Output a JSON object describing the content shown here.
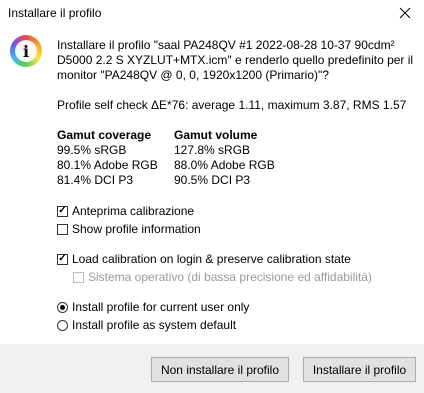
{
  "window": {
    "title": "Installare il profilo",
    "close_icon": "close-icon"
  },
  "icon": {
    "name": "color-info-icon",
    "glyph": "i"
  },
  "message": "Installare il profilo \"saal PA248QV #1 2022-08-28 10-37 90cdm² D5000 2.2 S XYZLUT+MTX.icm\" e renderlo quello predefinito per il monitor \"PA248QV @ 0, 0, 1920x1200 (Primario)\"?",
  "self_check": "Profile self check ΔE*76: average 1.11, maximum 3.87, RMS 1.57",
  "gamut_coverage": {
    "header": "Gamut coverage",
    "values": [
      "99.5% sRGB",
      "80.1% Adobe RGB",
      "81.4% DCI P3"
    ]
  },
  "gamut_volume": {
    "header": "Gamut volume",
    "values": [
      "127.8% sRGB",
      "88.0% Adobe RGB",
      "90.5% DCI P3"
    ]
  },
  "options": {
    "preview_calibration": {
      "label": "Anteprima calibrazione",
      "checked": true
    },
    "show_profile_info": {
      "label": "Show profile information",
      "checked": false
    },
    "load_calibration": {
      "label": "Load calibration on login & preserve calibration state",
      "checked": true
    },
    "os_option": {
      "label": "Sistema operativo (di bassa precisione ed affidabilità)",
      "checked": false,
      "disabled": true
    }
  },
  "install_scope": {
    "current_user": {
      "label": "Install profile for current user only",
      "selected": true
    },
    "system_default": {
      "label": "Install profile as system default",
      "selected": false
    }
  },
  "buttons": {
    "cancel": "Non installare il profilo",
    "install": "Installare il profilo"
  }
}
